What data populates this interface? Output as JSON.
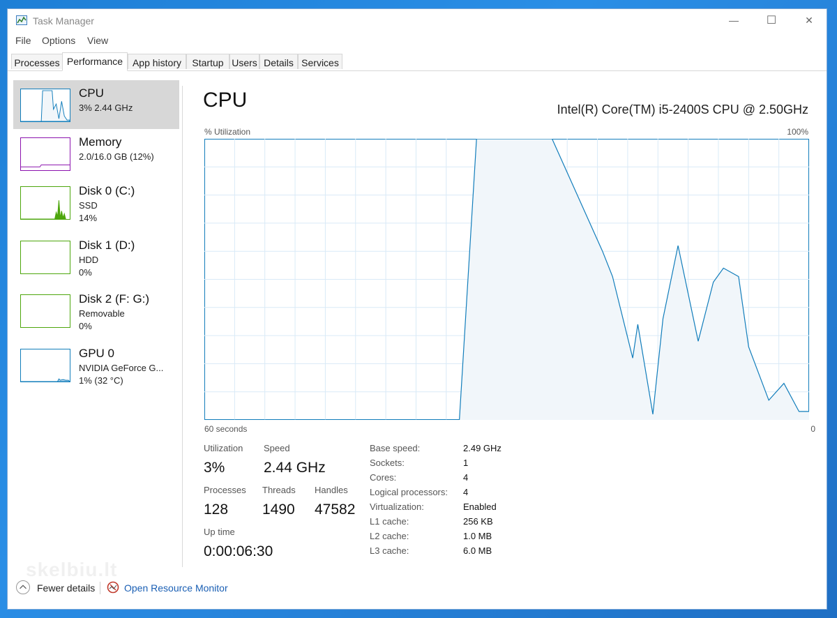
{
  "window": {
    "title": "Task Manager",
    "controls": {
      "minimize": "—",
      "maximize": "☐",
      "close": "✕"
    }
  },
  "menu": [
    "File",
    "Options",
    "View"
  ],
  "tabs": [
    "Processes",
    "Performance",
    "App history",
    "Startup",
    "Users",
    "Details",
    "Services"
  ],
  "active_tab": "Performance",
  "sidebar": [
    {
      "name": "CPU",
      "sub1": "3% 2.44 GHz",
      "color": "#117dbb"
    },
    {
      "name": "Memory",
      "sub1": "2.0/16.0 GB (12%)",
      "color": "#8b12ae"
    },
    {
      "name": "Disk 0 (C:)",
      "sub1": "SSD",
      "sub2": "14%",
      "color": "#4da60c"
    },
    {
      "name": "Disk 1 (D:)",
      "sub1": "HDD",
      "sub2": "0%",
      "color": "#4da60c"
    },
    {
      "name": "Disk 2 (F: G:)",
      "sub1": "Removable",
      "sub2": "0%",
      "color": "#4da60c"
    },
    {
      "name": "GPU 0",
      "sub1": "NVIDIA GeForce G...",
      "sub2": "1% (32 °C)",
      "color": "#117dbb"
    }
  ],
  "main": {
    "title": "CPU",
    "model": "Intel(R) Core(TM) i5-2400S CPU @ 2.50GHz",
    "graph_top_left": "% Utilization",
    "graph_top_right": "100%",
    "graph_bottom_left": "60 seconds",
    "graph_bottom_right": "0"
  },
  "stats": {
    "utilization_label": "Utilization",
    "utilization": "3%",
    "speed_label": "Speed",
    "speed": "2.44 GHz",
    "processes_label": "Processes",
    "processes": "128",
    "threads_label": "Threads",
    "threads": "1490",
    "handles_label": "Handles",
    "handles": "47582",
    "uptime_label": "Up time",
    "uptime": "0:00:06:30"
  },
  "specs": [
    {
      "label": "Base speed:",
      "value": "2.49 GHz"
    },
    {
      "label": "Sockets:",
      "value": "1"
    },
    {
      "label": "Cores:",
      "value": "4"
    },
    {
      "label": "Logical processors:",
      "value": "4"
    },
    {
      "label": "Virtualization:",
      "value": "Enabled"
    },
    {
      "label": "L1 cache:",
      "value": "256 KB"
    },
    {
      "label": "L2 cache:",
      "value": "1.0 MB"
    },
    {
      "label": "L3 cache:",
      "value": "6.0 MB"
    }
  ],
  "footer": {
    "fewer_details": "Fewer details",
    "open_monitor": "Open Resource Monitor"
  },
  "watermark": "skelbiu.lt",
  "chart_data": {
    "type": "area",
    "x_range": [
      60,
      0
    ],
    "ylim": [
      0,
      100
    ],
    "x": [
      60,
      34.7,
      33.0,
      31.5,
      25.5,
      20.5,
      19.5,
      17.5,
      17.0,
      15.5,
      14.5,
      13.0,
      11.0,
      9.5,
      8.5,
      7.0,
      6.0,
      4.0,
      2.5,
      1.0,
      0
    ],
    "y": [
      0,
      0,
      100,
      100,
      100,
      60,
      51,
      22,
      34,
      2,
      36,
      62,
      28,
      49,
      54,
      51,
      26,
      7,
      13,
      3,
      3
    ]
  }
}
